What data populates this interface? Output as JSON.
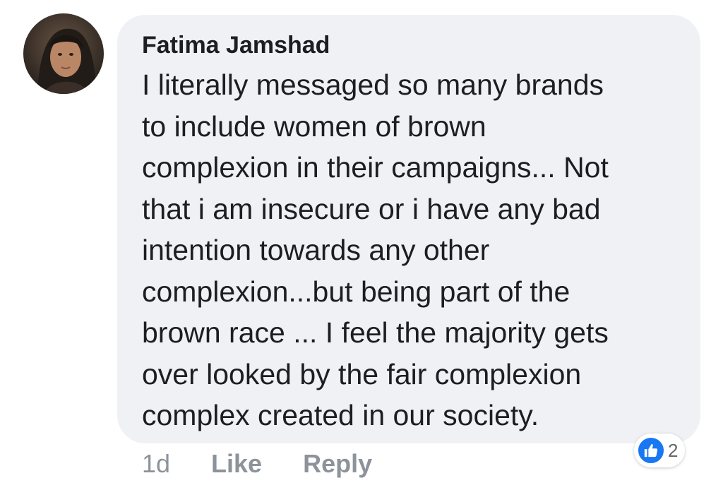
{
  "comment": {
    "author": "Fatima Jamshad",
    "lines": [
      "I literally messaged so many brands",
      "to include women of brown",
      "complexion in their campaigns... Not",
      "that i am insecure or i have any bad",
      "intention towards any other",
      "complexion...but being part of the",
      "brown race ... I feel the majority gets",
      "over looked by the fair complexion",
      "complex created in our society."
    ],
    "timestamp": "1d",
    "like_label": "Like",
    "reply_label": "Reply",
    "reaction_count": "2",
    "reaction_icon": "like-icon"
  },
  "colors": {
    "bubble": "#eff1f5",
    "text": "#1c1e21",
    "meta": "#8d939a",
    "like_blue": "#1877f2"
  }
}
